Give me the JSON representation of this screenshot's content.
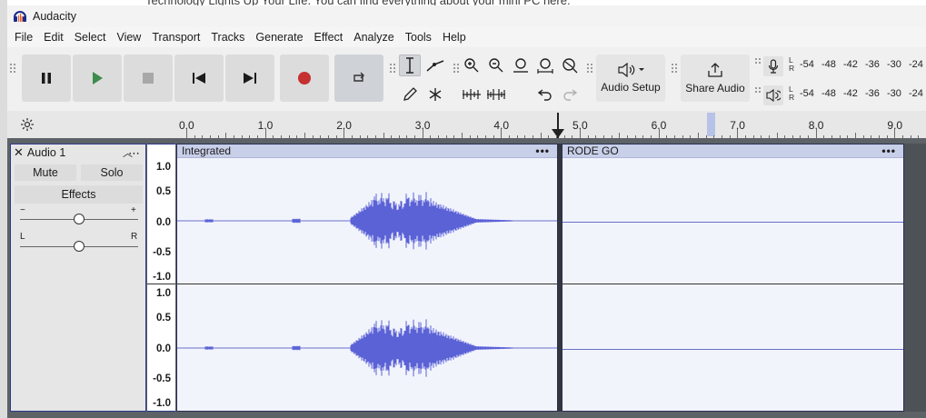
{
  "background": {
    "web_text": "Technology Lights Up Your Life. You can find everything about your mini PC here."
  },
  "window": {
    "title": "Audacity",
    "icon": "audacity-headphones-icon"
  },
  "menu": [
    "File",
    "Edit",
    "Select",
    "View",
    "Transport",
    "Tracks",
    "Generate",
    "Effect",
    "Analyze",
    "Tools",
    "Help"
  ],
  "toolbar": {
    "transport": [
      "pause-icon",
      "play-icon",
      "stop-icon",
      "skip-start-icon",
      "skip-end-icon",
      "record-icon",
      "loop-icon"
    ],
    "audio_setup_label": "Audio Setup",
    "share_audio_label": "Share Audio",
    "meter_scale": [
      "-54",
      "-48",
      "-42",
      "-36",
      "-30",
      "-24"
    ],
    "meter_channels": [
      "L",
      "R"
    ]
  },
  "timeline": {
    "ticks": [
      "0.0",
      "1.0",
      "2.0",
      "3.0",
      "4.0",
      "5.0",
      "6.0",
      "7.0",
      "8.0",
      "9.0"
    ]
  },
  "track": {
    "name": "Audio 1",
    "mute_label": "Mute",
    "solo_label": "Solo",
    "effects_label": "Effects",
    "gain_minus": "−",
    "gain_plus": "+",
    "pan_left": "L",
    "pan_right": "R",
    "gain_level": 0.5,
    "pan_level": 0.5
  },
  "vertical_ruler": [
    "1.0",
    "0.5",
    "0.0",
    "-0.5",
    "-1.0"
  ],
  "clips": [
    {
      "name": "Integrated",
      "menu": "•••"
    },
    {
      "name": "RODE GO",
      "menu": "•••"
    }
  ],
  "colors": {
    "waveform": "#5b62d6",
    "clip_header": "#c8cfe8",
    "record": "#c53030",
    "play": "#3c8c4c"
  }
}
